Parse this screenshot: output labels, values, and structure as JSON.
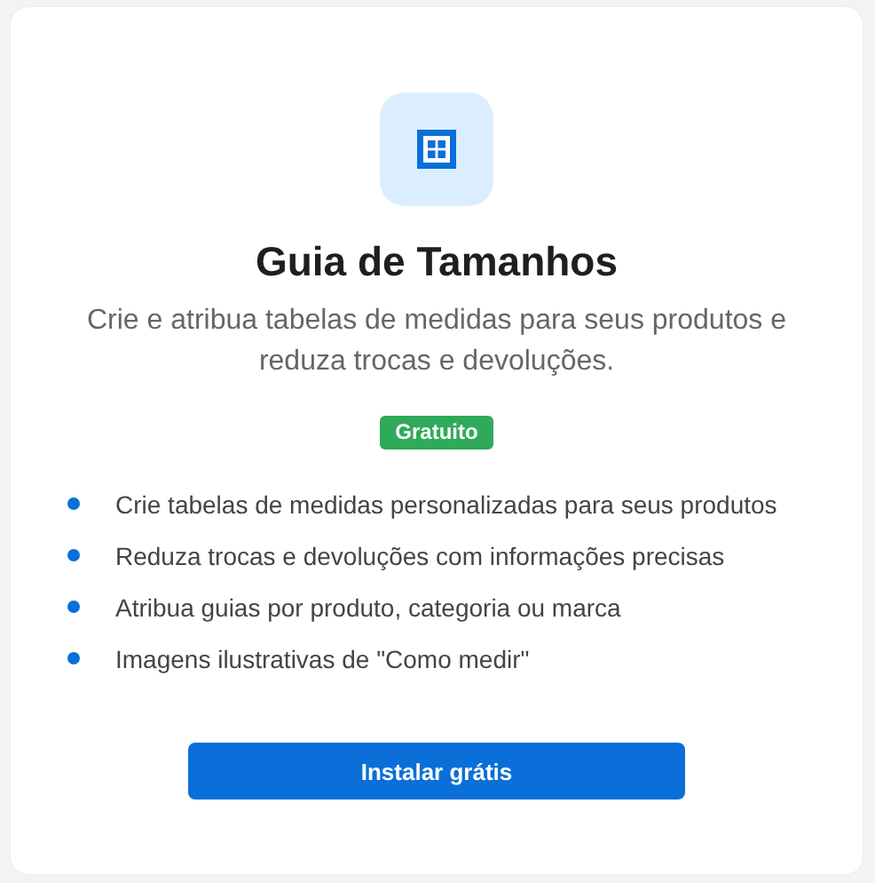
{
  "card": {
    "title": "Guia de Tamanhos",
    "description": "Crie e atribua tabelas de medidas para seus produtos e reduza trocas e devoluções.",
    "badge": "Gratuito",
    "features": [
      "Crie tabelas de medidas personalizadas para seus produtos",
      "Reduza trocas e devoluções com informações precisas",
      "Atribua guias por produto, categoria ou marca",
      "Imagens ilustrativas de \"Como medir\""
    ],
    "button": "Instalar grátis"
  }
}
